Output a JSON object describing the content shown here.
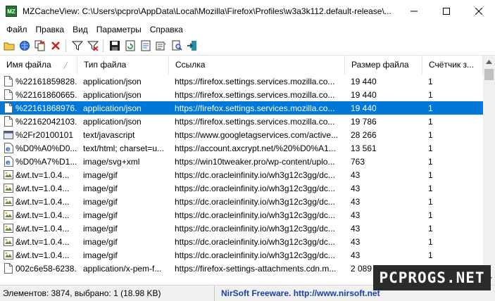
{
  "window": {
    "app_icon_text": "MZ",
    "title": "MZCacheView:  C:\\Users\\pcpro\\AppData\\Local\\Mozilla\\Firefox\\Profiles\\w3a3k112.default-release\\..."
  },
  "menu": [
    "Файл",
    "Правка",
    "Вид",
    "Параметры",
    "Справка"
  ],
  "toolbar": {
    "buttons": [
      "open-folder-icon",
      "globe-icon",
      "copy-icon",
      "delete-icon",
      "filter-icon",
      "filter-clear-icon",
      "save-icon",
      "refresh-icon",
      "html-report-icon",
      "properties-icon",
      "find-icon",
      "exit-icon"
    ]
  },
  "columns": [
    "Имя файла",
    "Тип файла",
    "Ссылка",
    "Размер файла",
    "Счётчик з..."
  ],
  "rows": [
    {
      "name": "%22161859828...",
      "type": "application/json",
      "url": "https://firefox.settings.services.mozilla.co...",
      "size": "19 440",
      "count": "1",
      "icon": "page",
      "selected": false
    },
    {
      "name": "%22161860665...",
      "type": "application/json",
      "url": "https://firefox.settings.services.mozilla.co...",
      "size": "19 440",
      "count": "1",
      "icon": "page",
      "selected": false
    },
    {
      "name": "%22161868976...",
      "type": "application/json",
      "url": "https://firefox.settings.services.mozilla.co...",
      "size": "19 440",
      "count": "1",
      "icon": "page",
      "selected": true
    },
    {
      "name": "%22162042103...",
      "type": "application/json",
      "url": "https://firefox.settings.services.mozilla.co...",
      "size": "19 786",
      "count": "1",
      "icon": "page",
      "selected": false
    },
    {
      "name": "%2Fr20100101",
      "type": "text/javascript",
      "url": "https://www.googletagservices.com/active...",
      "size": "28 266",
      "count": "1",
      "icon": "script",
      "selected": false
    },
    {
      "name": "%D0%A0%D0...",
      "type": "text/html; charset=u...",
      "url": "https://account.axcrypt.net/%20%D0%A1...",
      "size": "13 561",
      "count": "1",
      "icon": "html",
      "selected": false
    },
    {
      "name": "%D0%A7%D1...",
      "type": "image/svg+xml",
      "url": "https://win10tweaker.pro/wp-content/uplo...",
      "size": "763",
      "count": "1",
      "icon": "html",
      "selected": false
    },
    {
      "name": "&wt.tv=1.0.4...",
      "type": "image/gif",
      "url": "https://dc.oracleinfinity.io/wh3g12c3gg/dc...",
      "size": "43",
      "count": "1",
      "icon": "image",
      "selected": false
    },
    {
      "name": "&wt.tv=1.0.4...",
      "type": "image/gif",
      "url": "https://dc.oracleinfinity.io/wh3g12c3gg/dc...",
      "size": "43",
      "count": "1",
      "icon": "image",
      "selected": false
    },
    {
      "name": "&wt.tv=1.0.4...",
      "type": "image/gif",
      "url": "https://dc.oracleinfinity.io/wh3g12c3gg/dc...",
      "size": "43",
      "count": "1",
      "icon": "image",
      "selected": false
    },
    {
      "name": "&wt.tv=1.0.4...",
      "type": "image/gif",
      "url": "https://dc.oracleinfinity.io/wh3g12c3gg/dc...",
      "size": "43",
      "count": "1",
      "icon": "image",
      "selected": false
    },
    {
      "name": "&wt.tv=1.0.4...",
      "type": "image/gif",
      "url": "https://dc.oracleinfinity.io/wh3g12c3gg/dc...",
      "size": "43",
      "count": "1",
      "icon": "image",
      "selected": false
    },
    {
      "name": "&wt.tv=1.0.4...",
      "type": "image/gif",
      "url": "https://dc.oracleinfinity.io/wh3g12c3gg/dc...",
      "size": "43",
      "count": "1",
      "icon": "image",
      "selected": false
    },
    {
      "name": "&wt.tv=1.0.4...",
      "type": "image/gif",
      "url": "https://dc.oracleinfinity.io/wh3g12c3gg/dc...",
      "size": "43",
      "count": "1",
      "icon": "image",
      "selected": false
    },
    {
      "name": "002c6e58-6238...",
      "type": "application/x-pem-f...",
      "url": "https://firefox-settings-attachments.cdn.m...",
      "size": "2 089",
      "count": "1",
      "icon": "page",
      "selected": false
    }
  ],
  "status": {
    "items": "Элементов: 3874, выбрано: 1  (18.98 KB)",
    "nirsoft": "NirSoft Freeware.  http://www.nirsoft.net"
  },
  "watermark": "PCPROGS.NET",
  "colors": {
    "selection": "#0078d7",
    "nirsoft_link": "#1a3fa8"
  }
}
